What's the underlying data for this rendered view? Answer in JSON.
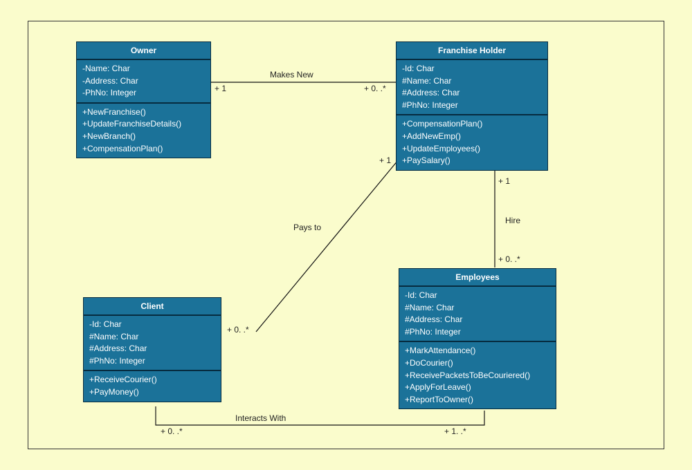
{
  "classes": {
    "owner": {
      "title": "Owner",
      "attrs": [
        "-Name: Char",
        "-Address: Char",
        "-PhNo: Integer"
      ],
      "ops": [
        "+NewFranchise()",
        "+UpdateFranchiseDetails()",
        "+NewBranch()",
        "+CompensationPlan()"
      ]
    },
    "franchise": {
      "title": "Franchise Holder",
      "attrs": [
        "-Id: Char",
        "#Name: Char",
        "#Address: Char",
        "#PhNo: Integer"
      ],
      "ops": [
        "+CompensationPlan()",
        "+AddNewEmp()",
        "+UpdateEmployees()",
        "+PaySalary()"
      ]
    },
    "client": {
      "title": "Client",
      "attrs": [
        "-Id: Char",
        "#Name: Char",
        "#Address: Char",
        "#PhNo: Integer"
      ],
      "ops": [
        "+ReceiveCourier()",
        "+PayMoney()"
      ]
    },
    "employees": {
      "title": "Employees",
      "attrs": [
        "-Id: Char",
        "#Name: Char",
        "#Address: Char",
        "#PhNo: Integer"
      ],
      "ops": [
        "+MarkAttendance()",
        "+DoCourier()",
        "+ReceivePacketsToBeCouriered()",
        "+ApplyForLeave()",
        "+ReportToOwner()"
      ]
    }
  },
  "assoc": {
    "makesNew": {
      "label": "Makes New",
      "m1": "+ 1",
      "m2": "+ 0. .*"
    },
    "paysTo": {
      "label": "Pays to",
      "m1": "+ 1",
      "m2": "+ 0. .*"
    },
    "hire": {
      "label": "Hire",
      "m1": "+ 1",
      "m2": "+ 0. .*"
    },
    "interacts": {
      "label": "Interacts With",
      "m1": "+ 0. .*",
      "m2": "+ 1. .*"
    }
  }
}
